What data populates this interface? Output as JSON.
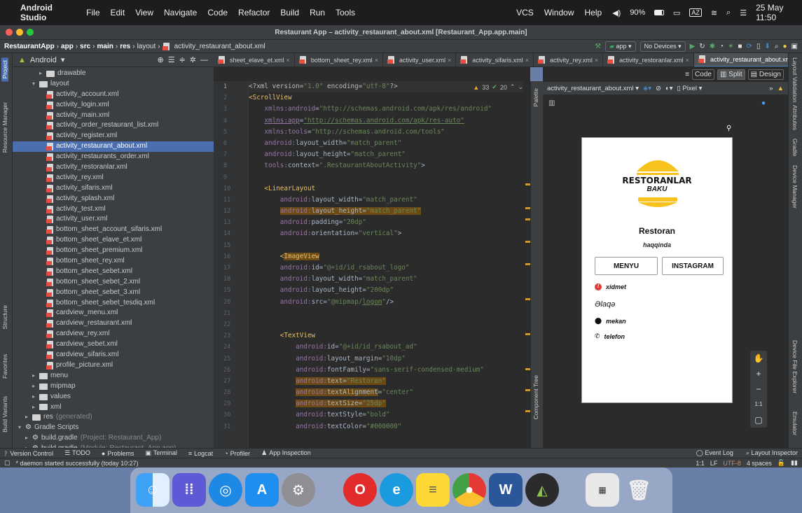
{
  "menubar": {
    "app": "Android Studio",
    "items": [
      "File",
      "Edit",
      "View",
      "Navigate",
      "Code",
      "Refactor",
      "Build",
      "Run",
      "Tools"
    ],
    "vcs": "VCS",
    "window": "Window",
    "help": "Help",
    "battery": "90%",
    "lang": "AZ",
    "date": "25 May 11:50"
  },
  "window": {
    "title": "Restaurant App – activity_restaurant_about.xml [Restaurant_App.app.main]"
  },
  "breadcrumb": [
    "RestaurantApp",
    "app",
    "src",
    "main",
    "res",
    "layout",
    "activity_restaurant_about.xml"
  ],
  "toolbar": {
    "module": "app",
    "devices": "No Devices"
  },
  "project": {
    "view": "Android",
    "items": [
      {
        "t": "drawable",
        "k": "folder",
        "d": 3
      },
      {
        "t": "layout",
        "k": "folder",
        "d": 2,
        "o": true
      },
      {
        "t": "activity_account.xml",
        "k": "xml",
        "d": 4
      },
      {
        "t": "activity_login.xml",
        "k": "xml",
        "d": 4
      },
      {
        "t": "activity_main.xml",
        "k": "xml",
        "d": 4
      },
      {
        "t": "activity_order_restaurant_list.xml",
        "k": "xml",
        "d": 4
      },
      {
        "t": "activity_register.xml",
        "k": "xml",
        "d": 4
      },
      {
        "t": "activity_restaurant_about.xml",
        "k": "xml",
        "d": 4,
        "s": true
      },
      {
        "t": "activity_restaurants_order.xml",
        "k": "xml",
        "d": 4
      },
      {
        "t": "activity_restoranlar.xml",
        "k": "xml",
        "d": 4
      },
      {
        "t": "activity_rey.xml",
        "k": "xml",
        "d": 4
      },
      {
        "t": "activity_sifaris.xml",
        "k": "xml",
        "d": 4
      },
      {
        "t": "activity_splash.xml",
        "k": "xml",
        "d": 4
      },
      {
        "t": "activity_test.xml",
        "k": "xml",
        "d": 4
      },
      {
        "t": "activity_user.xml",
        "k": "xml",
        "d": 4
      },
      {
        "t": "bottom_sheet_account_sifaris.xml",
        "k": "xml",
        "d": 4
      },
      {
        "t": "bottom_sheet_elave_et.xml",
        "k": "xml",
        "d": 4
      },
      {
        "t": "bottom_sheet_premium.xml",
        "k": "xml",
        "d": 4
      },
      {
        "t": "bottom_sheet_rey.xml",
        "k": "xml",
        "d": 4
      },
      {
        "t": "bottom_sheet_sebet.xml",
        "k": "xml",
        "d": 4
      },
      {
        "t": "bottom_sheet_sebet_2.xml",
        "k": "xml",
        "d": 4
      },
      {
        "t": "bottom_sheet_sebet_3.xml",
        "k": "xml",
        "d": 4
      },
      {
        "t": "bottom_sheet_sebet_tesdiq.xml",
        "k": "xml",
        "d": 4
      },
      {
        "t": "cardview_menu.xml",
        "k": "xml",
        "d": 4
      },
      {
        "t": "cardview_restaurant.xml",
        "k": "xml",
        "d": 4
      },
      {
        "t": "cardview_rey.xml",
        "k": "xml",
        "d": 4
      },
      {
        "t": "cardview_sebet.xml",
        "k": "xml",
        "d": 4
      },
      {
        "t": "cardview_sifaris.xml",
        "k": "xml",
        "d": 4
      },
      {
        "t": "profile_picture.xml",
        "k": "xml",
        "d": 4
      },
      {
        "t": "menu",
        "k": "folder",
        "d": 2
      },
      {
        "t": "mipmap",
        "k": "folder",
        "d": 2
      },
      {
        "t": "values",
        "k": "folder",
        "d": 2
      },
      {
        "t": "xml",
        "k": "folder",
        "d": 2
      },
      {
        "t": "res",
        "k": "folder",
        "d": 1,
        "x": "(generated)"
      },
      {
        "t": "Gradle Scripts",
        "k": "gradle",
        "d": 0,
        "o": true
      },
      {
        "t": "build.gradle",
        "k": "gradle",
        "d": 1,
        "x": "(Project: Restaurant_App)"
      },
      {
        "t": "build.gradle",
        "k": "gradle",
        "d": 1,
        "x": "(Module: Restaurant_App.app)"
      }
    ]
  },
  "tabs": [
    "sheet_elave_et.xml",
    "bottom_sheet_rey.xml",
    "activity_user.xml",
    "activity_sifaris.xml",
    "activity_rey.xml",
    "activity_restoranlar.xml",
    "activity_restaurant_about.xml"
  ],
  "editor": {
    "warnings": "33",
    "checks": "20",
    "lines": [
      {
        "n": "1",
        "h": "<span class='c-attr'>&lt;?xml </span><span class='c-attr'>version=</span><span class='c-val'>\"1.0\"</span><span class='c-attr'> encoding=</span><span class='c-val'>\"utf-8\"</span><span class='c-attr'>?&gt;</span>"
      },
      {
        "n": "2",
        "h": "<span class='c-tag'>&lt;ScrollView</span>"
      },
      {
        "n": "3",
        "h": "    <span class='c-ns'>xmlns:android</span>=<span class='c-val'>\"http://schemas.android.com/apk/res/android\"</span>"
      },
      {
        "n": "4",
        "h": "    <span class='c-ns' style='text-decoration:underline'>xmlns:app</span>=<span class='c-val' style='text-decoration:underline'>\"http://schemas.android.com/apk/res-auto\"</span>"
      },
      {
        "n": "5",
        "h": "    <span class='c-ns'>xmlns:tools</span>=<span class='c-val'>\"http://schemas.android.com/tools\"</span>"
      },
      {
        "n": "6",
        "h": "    <span class='c-ns'>android:</span>layout_width=<span class='c-val'>\"match_parent\"</span>"
      },
      {
        "n": "7",
        "h": "    <span class='c-ns'>android:</span>layout_height=<span class='c-val'>\"match_parent\"</span>"
      },
      {
        "n": "8",
        "h": "    <span class='c-ns'>tools:</span>context=<span class='c-val'>\".RestaurantAboutActivity\"</span>&gt;"
      },
      {
        "n": "9",
        "h": ""
      },
      {
        "n": "10",
        "h": "    <span class='c-tag'>&lt;LinearLayout</span>"
      },
      {
        "n": "11",
        "h": "        <span class='c-ns'>android:</span>layout_width=<span class='c-val'>\"match_parent\"</span>"
      },
      {
        "n": "12",
        "h": "        <span class='hl'><span class='c-ns'>android:</span>layout_height=<span class='c-val'>\"match_parent\"</span></span>"
      },
      {
        "n": "13",
        "h": "        <span class='c-ns'>android:</span>padding=<span class='c-val'>\"20dp\"</span>"
      },
      {
        "n": "14",
        "h": "        <span class='c-ns'>android:</span>orientation=<span class='c-val'>\"vertical\"</span>&gt;"
      },
      {
        "n": "15",
        "h": ""
      },
      {
        "n": "16",
        "h": "        <span class='c-tag'>&lt;<span class='hl'>ImageView</span></span>"
      },
      {
        "n": "17",
        "h": "        <span class='c-ns'>android:</span>id=<span class='c-val'>\"@+id/id_rsabout_logo\"</span>"
      },
      {
        "n": "18",
        "h": "        <span class='c-ns'>android:</span>layout_width=<span class='c-val'>\"match_parent\"</span>"
      },
      {
        "n": "19",
        "h": "        <span class='c-ns'>android:</span>layout_height=<span class='c-val'>\"200dp\"</span>"
      },
      {
        "n": "20",
        "h": "        <span class='c-ns'>android:</span>src=<span class='c-val'>\"@mipmap/<u>logom</u>\"</span>/&gt;"
      },
      {
        "n": "21",
        "h": ""
      },
      {
        "n": "22",
        "h": ""
      },
      {
        "n": "23",
        "h": "        <span class='c-tag'>&lt;TextView</span>"
      },
      {
        "n": "24",
        "h": "            <span class='c-ns'>android:</span>id=<span class='c-val'>\"@+id/id_rsabout_ad\"</span>"
      },
      {
        "n": "25",
        "h": "            <span class='c-ns'>android:</span>layout_margin=<span class='c-val'>\"10dp\"</span>"
      },
      {
        "n": "26",
        "h": "            <span class='c-ns'>android:</span>fontFamily=<span class='c-val'>\"sans-serif-condensed-medium\"</span>"
      },
      {
        "n": "27",
        "h": "            <span class='hl'><span class='c-ns'>android:</span>text=<span class='c-val'>\"Restoran\"</span></span>"
      },
      {
        "n": "28",
        "h": "            <span class='hl'><span class='c-ns'>android:</span>textAlignment</span>=<span class='c-val'>\"center\"</span>"
      },
      {
        "n": "29",
        "h": "            <span class='hl'><span class='c-ns'>android:</span>textSize=<span class='c-val'>\"25dp\"</span></span>"
      },
      {
        "n": "30",
        "h": "            <span class='c-ns'>android:</span>textStyle=<span class='c-val'>\"bold\"</span>"
      },
      {
        "n": "31",
        "h": "            <span class='c-ns'>android:</span>textColor=<span class='c-val'>\"#000000\"</span>"
      }
    ]
  },
  "design": {
    "code": "Code",
    "split": "Split",
    "design": "Design",
    "file": "activity_restaurant_about.xml",
    "device": "Pixel"
  },
  "preview": {
    "logo_title": "RESTORANLAR",
    "logo_sub": "BAKU",
    "name": "Restoran",
    "subtitle": "haqqinda",
    "menu_btn": "MENYU",
    "insta_btn": "INSTAGRAM",
    "xidmet": "xidmet",
    "elaqe": "Əlaqə",
    "mekan": "mekan",
    "telefon": "telefon"
  },
  "sidepanels": {
    "left": [
      "Project",
      "Resource Manager",
      "Structure",
      "Favorites",
      "Build Variants"
    ],
    "right": [
      "Layout Validation",
      "Attributes",
      "Gradle",
      "Device Manager",
      "Device File Explorer",
      "Emulator"
    ],
    "palette": "Palette",
    "comptree": "Component Tree"
  },
  "bottom": {
    "items": [
      "Version Control",
      "TODO",
      "Problems",
      "Terminal",
      "Logcat",
      "Profiler",
      "App Inspection"
    ],
    "event": "Event Log",
    "inspector": "Layout Inspector"
  },
  "status": {
    "message": "* daemon started successfully (today 10:27)",
    "pos": "1:1",
    "lf": "LF",
    "enc": "UTF-8",
    "indent": "4 spaces"
  }
}
